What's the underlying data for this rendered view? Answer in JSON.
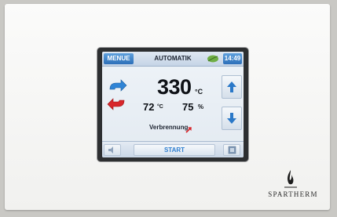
{
  "topbar": {
    "menu_label": "MENUE",
    "mode_label": "AUTOMATIK",
    "time": "14:49",
    "leaf_icon": "leaf-icon"
  },
  "readout": {
    "main_temp": "330",
    "main_unit": "°C",
    "secondary_temp": "72",
    "secondary_unit": "°C",
    "humidity": "75",
    "humidity_unit": "%"
  },
  "status": {
    "text": "Verbrennung",
    "icon": "red-arrow-up-right-icon"
  },
  "controls": {
    "up_icon": "arrow-up-icon",
    "down_icon": "arrow-down-icon",
    "start_label": "START",
    "sound_icon": "speaker-icon",
    "corner_icon": "settings-square-icon"
  },
  "brand": {
    "name": "SPARTHERM"
  },
  "colors": {
    "accent_blue": "#2c6fb8",
    "arrow_red": "#d8262b",
    "arrow_blue": "#2f84d6"
  }
}
